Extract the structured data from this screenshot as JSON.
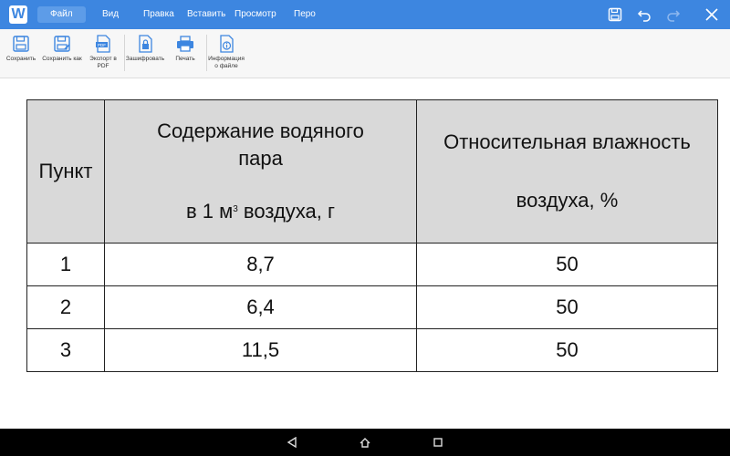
{
  "app": {
    "logo_letter": "W",
    "menu": {
      "file": "Файл",
      "view": "Вид",
      "edit": "Правка",
      "insert": "Вставить",
      "review": "Просмотр",
      "pen": "Перо"
    }
  },
  "toolbar": {
    "save": "Сохранить",
    "save_as": "Сохранить как",
    "export_pdf": "Экспорт в PDF",
    "encrypt": "Зашифровать",
    "print": "Печать",
    "file_info": "Информация о файле",
    "pdf_badge": "PDF"
  },
  "table": {
    "headers": {
      "col1": "Пункт",
      "col2_line1": "Содержание водяного",
      "col2_line2": "пара",
      "col2_line3_pre": "в 1 м",
      "col2_line3_sup": "3",
      "col2_line3_post": " воздуха, г",
      "col3_line1": "Относительная влажность",
      "col3_line2": "воздуха, %"
    },
    "rows": [
      {
        "point": "1",
        "vapor": "8,7",
        "humidity": "50"
      },
      {
        "point": "2",
        "vapor": "6,4",
        "humidity": "50"
      },
      {
        "point": "3",
        "vapor": "11,5",
        "humidity": "50"
      }
    ]
  },
  "colors": {
    "accent": "#3d86e0",
    "header_fill": "#d9d9d9"
  }
}
